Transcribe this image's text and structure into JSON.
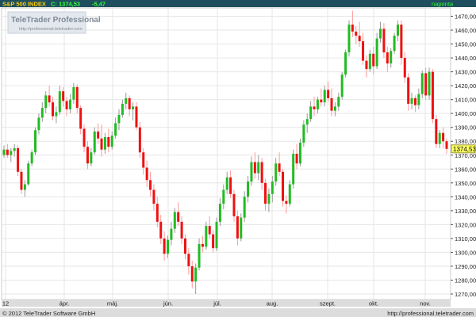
{
  "header": {
    "instrument": "S&P 500 INDEX",
    "close_label": "C: 1374,53",
    "change": "-5,47",
    "period": "naponta",
    "colors": {
      "bar": "#1f4f5f",
      "instrument": "#ffcc00",
      "text": "#33ff33"
    }
  },
  "watermark": {
    "brand": "TeleTrader Professional",
    "url": "http://professional.teletrader.com"
  },
  "footer": {
    "copyright": "© 2012 TeleTrader Software GmbH",
    "url": "http://professional.teletrader.com",
    "colors": {
      "bar": "#dcdcdc"
    }
  },
  "price_label": "1374,53",
  "chart_data": {
    "type": "candlestick",
    "title": "S&P 500 INDEX",
    "period": "naponta",
    "y_ticks": [
      "1270,00",
      "1280,00",
      "1290,00",
      "1300,00",
      "1310,00",
      "1320,00",
      "1330,00",
      "1340,00",
      "1350,00",
      "1360,00",
      "1370,00",
      "1380,00",
      "1390,00",
      "1400,00",
      "1410,00",
      "1420,00",
      "1430,00",
      "1440,00",
      "1450,00",
      "1460,00",
      "1470,00"
    ],
    "x_ticks": [
      "12",
      "ápr.",
      "máj.",
      "jún.",
      "júl.",
      "aug.",
      "szept.",
      "okt.",
      "nov."
    ],
    "ylim": [
      1266,
      1476
    ],
    "last_close": 1374.53,
    "change": -5.47,
    "colors": {
      "up": "#22bb22",
      "down": "#ee1111"
    },
    "candles": [
      [
        1370,
        1377,
        1368,
        1374
      ],
      [
        1374,
        1378,
        1368,
        1370
      ],
      [
        1370,
        1375,
        1365,
        1373
      ],
      [
        1373,
        1378,
        1369,
        1375
      ],
      [
        1375,
        1377,
        1355,
        1358
      ],
      [
        1358,
        1360,
        1342,
        1345
      ],
      [
        1345,
        1352,
        1340,
        1349
      ],
      [
        1349,
        1366,
        1348,
        1364
      ],
      [
        1364,
        1374,
        1362,
        1372
      ],
      [
        1372,
        1390,
        1370,
        1388
      ],
      [
        1388,
        1400,
        1385,
        1397
      ],
      [
        1397,
        1408,
        1394,
        1404
      ],
      [
        1404,
        1416,
        1400,
        1413
      ],
      [
        1413,
        1420,
        1405,
        1408
      ],
      [
        1408,
        1412,
        1395,
        1398
      ],
      [
        1398,
        1405,
        1393,
        1401
      ],
      [
        1401,
        1420,
        1399,
        1416
      ],
      [
        1416,
        1419,
        1405,
        1409
      ],
      [
        1409,
        1412,
        1398,
        1403
      ],
      [
        1403,
        1414,
        1400,
        1410
      ],
      [
        1410,
        1422,
        1407,
        1419
      ],
      [
        1419,
        1421,
        1400,
        1404
      ],
      [
        1404,
        1406,
        1385,
        1389
      ],
      [
        1389,
        1392,
        1372,
        1376
      ],
      [
        1376,
        1380,
        1360,
        1364
      ],
      [
        1364,
        1375,
        1362,
        1372
      ],
      [
        1372,
        1390,
        1370,
        1387
      ],
      [
        1387,
        1393,
        1378,
        1382
      ],
      [
        1382,
        1392,
        1369,
        1374
      ],
      [
        1374,
        1386,
        1371,
        1383
      ],
      [
        1383,
        1389,
        1372,
        1376
      ],
      [
        1376,
        1387,
        1374,
        1384
      ],
      [
        1384,
        1397,
        1382,
        1393
      ],
      [
        1393,
        1403,
        1388,
        1399
      ],
      [
        1399,
        1410,
        1397,
        1407
      ],
      [
        1407,
        1415,
        1403,
        1411
      ],
      [
        1411,
        1413,
        1398,
        1403
      ],
      [
        1403,
        1408,
        1395,
        1405
      ],
      [
        1405,
        1408,
        1388,
        1390
      ],
      [
        1390,
        1394,
        1368,
        1372
      ],
      [
        1372,
        1375,
        1356,
        1361
      ],
      [
        1361,
        1366,
        1347,
        1352
      ],
      [
        1352,
        1358,
        1340,
        1345
      ],
      [
        1345,
        1349,
        1330,
        1335
      ],
      [
        1335,
        1340,
        1318,
        1322
      ],
      [
        1322,
        1327,
        1306,
        1310
      ],
      [
        1310,
        1315,
        1294,
        1299
      ],
      [
        1299,
        1312,
        1296,
        1309
      ],
      [
        1309,
        1322,
        1305,
        1317
      ],
      [
        1317,
        1332,
        1314,
        1329
      ],
      [
        1329,
        1336,
        1319,
        1322
      ],
      [
        1322,
        1326,
        1306,
        1310
      ],
      [
        1310,
        1313,
        1295,
        1299
      ],
      [
        1299,
        1303,
        1284,
        1290
      ],
      [
        1290,
        1294,
        1274,
        1279
      ],
      [
        1279,
        1292,
        1270,
        1289
      ],
      [
        1289,
        1310,
        1287,
        1306
      ],
      [
        1306,
        1312,
        1300,
        1304
      ],
      [
        1304,
        1322,
        1302,
        1319
      ],
      [
        1319,
        1326,
        1310,
        1313
      ],
      [
        1313,
        1316,
        1300,
        1303
      ],
      [
        1303,
        1325,
        1301,
        1322
      ],
      [
        1322,
        1339,
        1319,
        1335
      ],
      [
        1335,
        1349,
        1331,
        1345
      ],
      [
        1345,
        1358,
        1342,
        1354
      ],
      [
        1354,
        1359,
        1339,
        1342
      ],
      [
        1342,
        1345,
        1322,
        1326
      ],
      [
        1326,
        1330,
        1305,
        1310
      ],
      [
        1310,
        1328,
        1308,
        1325
      ],
      [
        1325,
        1344,
        1322,
        1340
      ],
      [
        1340,
        1355,
        1336,
        1351
      ],
      [
        1351,
        1369,
        1348,
        1365
      ],
      [
        1365,
        1372,
        1353,
        1357
      ],
      [
        1357,
        1370,
        1352,
        1365
      ],
      [
        1365,
        1368,
        1345,
        1350
      ],
      [
        1350,
        1353,
        1330,
        1335
      ],
      [
        1335,
        1346,
        1329,
        1342
      ],
      [
        1342,
        1355,
        1336,
        1351
      ],
      [
        1351,
        1368,
        1348,
        1364
      ],
      [
        1364,
        1372,
        1355,
        1358
      ],
      [
        1358,
        1360,
        1333,
        1337
      ],
      [
        1337,
        1341,
        1328,
        1335
      ],
      [
        1335,
        1352,
        1333,
        1349
      ],
      [
        1349,
        1374,
        1346,
        1371
      ],
      [
        1371,
        1378,
        1360,
        1364
      ],
      [
        1364,
        1382,
        1362,
        1379
      ],
      [
        1379,
        1395,
        1376,
        1392
      ],
      [
        1392,
        1400,
        1386,
        1396
      ],
      [
        1396,
        1409,
        1394,
        1405
      ],
      [
        1405,
        1412,
        1398,
        1403
      ],
      [
        1403,
        1412,
        1400,
        1410
      ],
      [
        1410,
        1418,
        1405,
        1408
      ],
      [
        1408,
        1420,
        1405,
        1417
      ],
      [
        1417,
        1423,
        1408,
        1411
      ],
      [
        1411,
        1418,
        1398,
        1402
      ],
      [
        1402,
        1408,
        1398,
        1405
      ],
      [
        1405,
        1415,
        1402,
        1412
      ],
      [
        1412,
        1430,
        1410,
        1428
      ],
      [
        1428,
        1446,
        1426,
        1444
      ],
      [
        1444,
        1467,
        1441,
        1464
      ],
      [
        1464,
        1474,
        1455,
        1459
      ],
      [
        1459,
        1463,
        1450,
        1456
      ],
      [
        1456,
        1466,
        1448,
        1452
      ],
      [
        1452,
        1458,
        1435,
        1438
      ],
      [
        1438,
        1442,
        1426,
        1432
      ],
      [
        1432,
        1446,
        1430,
        1443
      ],
      [
        1443,
        1448,
        1428,
        1434
      ],
      [
        1434,
        1458,
        1432,
        1454
      ],
      [
        1454,
        1466,
        1451,
        1461
      ],
      [
        1461,
        1465,
        1440,
        1444
      ],
      [
        1444,
        1448,
        1430,
        1436
      ],
      [
        1436,
        1447,
        1433,
        1445
      ],
      [
        1445,
        1458,
        1443,
        1456
      ],
      [
        1456,
        1467,
        1452,
        1464
      ],
      [
        1464,
        1467,
        1435,
        1440
      ],
      [
        1440,
        1444,
        1422,
        1426
      ],
      [
        1426,
        1429,
        1402,
        1407
      ],
      [
        1407,
        1415,
        1403,
        1411
      ],
      [
        1411,
        1413,
        1401,
        1406
      ],
      [
        1406,
        1418,
        1403,
        1414
      ],
      [
        1414,
        1431,
        1411,
        1429
      ],
      [
        1429,
        1433,
        1410,
        1413
      ],
      [
        1413,
        1433,
        1410,
        1430
      ],
      [
        1430,
        1432,
        1393,
        1396
      ],
      [
        1396,
        1399,
        1375,
        1378
      ],
      [
        1378,
        1388,
        1375,
        1386
      ],
      [
        1386,
        1390,
        1375,
        1380
      ],
      [
        1380,
        1382,
        1371,
        1374.53
      ]
    ]
  }
}
